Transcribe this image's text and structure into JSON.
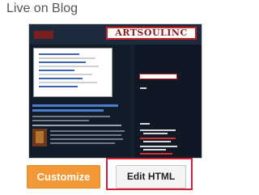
{
  "heading": "Live on Blog",
  "preview": {
    "logo_text": "ARTSOULINC",
    "accent_color": "#c62020",
    "background_color": "#152030"
  },
  "buttons": {
    "customize_label": "Customize",
    "edit_html_label": "Edit HTML",
    "customize_color": "#f39836",
    "highlight_color": "#d42030"
  }
}
